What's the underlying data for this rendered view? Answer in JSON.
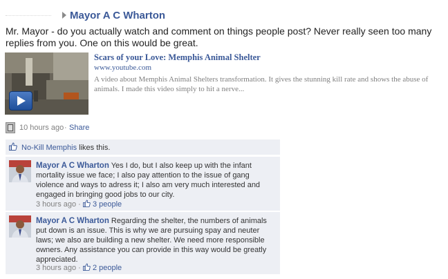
{
  "post": {
    "author": "Mayor A C Wharton",
    "message": "Mr. Mayor - do you actually watch and comment on things people post? Never really seen too many replies from you. One on this would be great.",
    "time": "10 hours ago",
    "separator": "·",
    "share_label": "Share"
  },
  "attachment": {
    "title": "Scars of your Love: Memphis Animal Shelter",
    "domain": "www.youtube.com",
    "description": "A video about Memphis Animal Shelters transformation. It gives the stunning kill rate and shows the abuse of animals. I made this video simply to hit a nerve..."
  },
  "likes": {
    "liker": "No-Kill Memphis",
    "suffix": " likes this."
  },
  "comments": [
    {
      "author": "Mayor A C Wharton",
      "text": " Yes I do, but I also keep up with the infant mortality issue we face; I also pay attention to the issue of gang violence and ways to adress it; I also am very much interested and engaged in bringing good jobs to our city.",
      "time": "3 hours ago",
      "separator": "·",
      "likes": "3 people"
    },
    {
      "author": "Mayor A C Wharton",
      "text": " Regarding the shelter, the numbers of animals put down is an issue. This is why we are pursuing spay and neuter laws; we also are building a new shelter. We need more responsible owners. Any assistance you can provide in this way would be greatly appreciated.",
      "time": "3 hours ago",
      "separator": "·",
      "likes": "2 people"
    }
  ],
  "colors": {
    "link": "#3b5998",
    "panel": "#edeff4",
    "muted": "#808080"
  }
}
